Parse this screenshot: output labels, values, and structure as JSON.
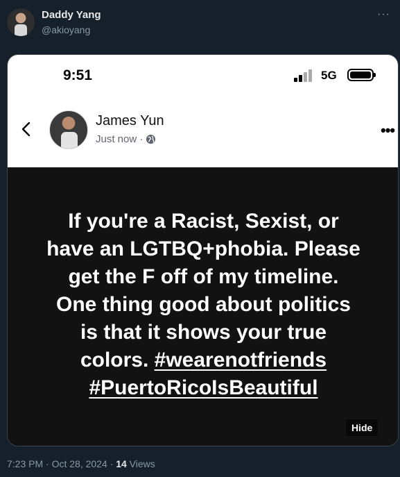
{
  "tweet": {
    "author_name": "Daddy Yang",
    "author_handle": "@akioyang",
    "more_glyph": "···",
    "timestamp": "7:23 PM · Oct 28, 2024",
    "separator": " · ",
    "views_count": "14",
    "views_label": " Views"
  },
  "screenshot": {
    "status_time": "9:51",
    "network": "5G",
    "poster_name": "James Yun",
    "poster_time": "Just now ·",
    "post_lines": [
      "If you're a Racist, Sexist, or",
      "have an LGTBQ+phobia. Please",
      "get the F off of my timeline.",
      "One thing good about politics",
      "is that it shows your true",
      "colors. "
    ],
    "hashtag_1": "#wearenotfriends",
    "hashtag_2": "#PuertoRicoIsBeautiful",
    "hide_label": "Hide",
    "more_glyph": "•••"
  },
  "icons": {
    "signal": "signal-bars-icon",
    "battery": "battery-icon",
    "back": "chevron-left-icon",
    "globe": "globe-icon"
  },
  "colors": {
    "page_bg": "#15202b",
    "post_bg": "#121212",
    "secondary_text": "#8b98a5"
  }
}
